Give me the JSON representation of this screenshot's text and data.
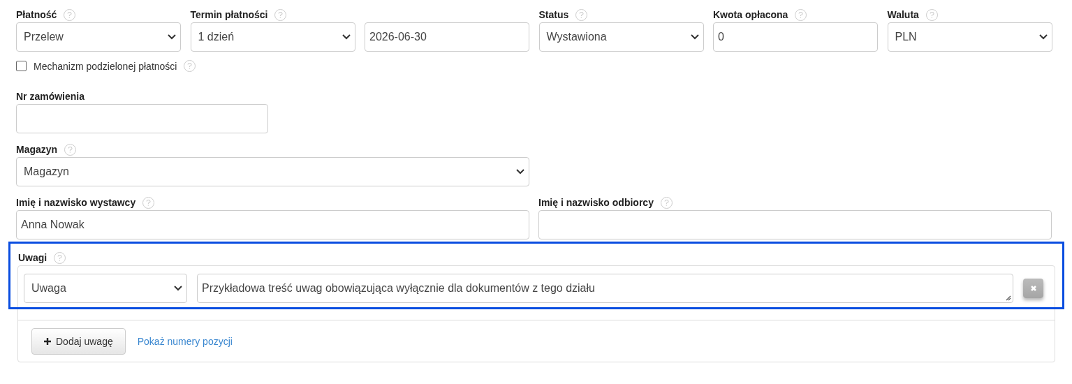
{
  "payment_row": [
    {
      "label": "Płatność",
      "help": true,
      "kind": "select",
      "value": "Przelew"
    },
    {
      "label": "Termin płatności",
      "help": true,
      "kind": "select",
      "value": "1 dzień"
    },
    {
      "kind": "input",
      "value": "2026-06-30"
    },
    {
      "label": "Status",
      "help": true,
      "kind": "select",
      "value": "Wystawiona"
    },
    {
      "label": "Kwota opłacona",
      "help": true,
      "kind": "input",
      "value": "0"
    },
    {
      "label": "Waluta",
      "help": true,
      "kind": "select",
      "value": "PLN"
    }
  ],
  "split_payment": {
    "label": "Mechanizm podzielonej płatności",
    "checked": false,
    "help": true
  },
  "order_number": {
    "label": "Nr zamówienia",
    "kind": "input"
  },
  "warehouse": {
    "label": "Magazyn",
    "help": true,
    "kind": "select",
    "value": "Magazyn"
  },
  "people": [
    {
      "label": "Imię i nazwisko wystawcy",
      "help": true,
      "kind": "input",
      "value": "Anna Nowak"
    },
    {
      "label": "Imię i nazwisko odbiorcy",
      "help": true,
      "kind": "input"
    }
  ],
  "notes": {
    "label": "Uwagi",
    "help": true,
    "highlighted": true,
    "items": [
      {
        "type": "Uwaga",
        "text": "Przykładowa treść uwag obowiązująca wyłącznie dla dokumentów z tego działu"
      }
    ],
    "add_button": "Dodaj uwagę",
    "link": "Pokaż numery pozycji"
  }
}
